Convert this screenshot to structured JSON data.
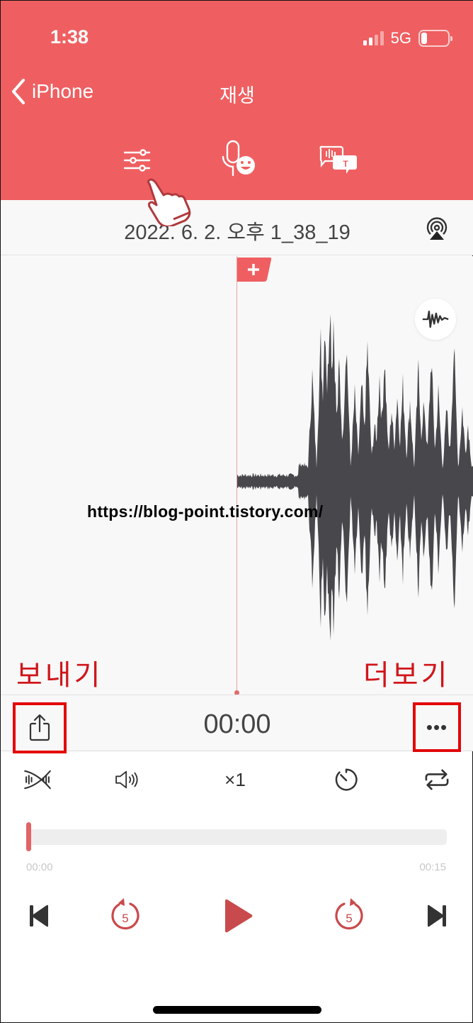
{
  "status_bar": {
    "time": "1:38",
    "network": "5G",
    "signal_bars": 2,
    "signal_total": 4,
    "battery_level": 0.15
  },
  "nav": {
    "back_label": "iPhone",
    "title": "재생"
  },
  "toolbar": {
    "items": [
      {
        "icon": "sliders-icon",
        "label": "settings"
      },
      {
        "icon": "voice-emoji-icon",
        "label": "voice effects"
      },
      {
        "icon": "speech-to-text-icon",
        "label": "transcribe"
      }
    ]
  },
  "recording": {
    "title": "2022. 6. 2. 오후 1_38_19"
  },
  "waveform": {
    "watermark": "https://blog-point.tistory.com/",
    "bookmark_label": "+",
    "annotation_left": "보내기",
    "annotation_right": "더보기"
  },
  "playback": {
    "current_time": "00:00",
    "more_label": "•••",
    "speed_label": "×1",
    "progress_fraction": 0,
    "start_time": "00:00",
    "end_time": "00:15",
    "skip_back_seconds": "5",
    "skip_forward_seconds": "5"
  },
  "colors": {
    "accent": "#ef5f61",
    "annotation_red": "#e3070a",
    "play_red": "#c94a4c",
    "waveform": "#48474c"
  }
}
